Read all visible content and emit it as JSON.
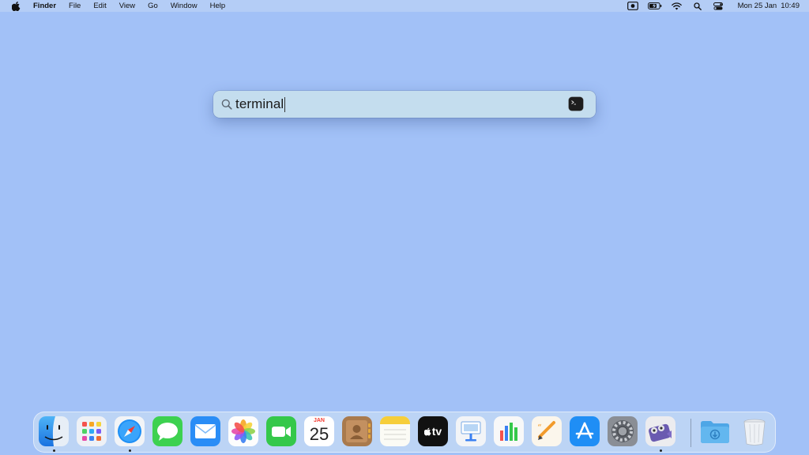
{
  "menubar": {
    "app_name": "Finder",
    "menus": [
      "File",
      "Edit",
      "View",
      "Go",
      "Window",
      "Help"
    ],
    "status_icons": [
      "screen-record-icon",
      "battery-icon",
      "wifi-icon",
      "spotlight-search-icon",
      "control-center-icon"
    ],
    "clock": {
      "date": "Mon 25 Jan",
      "time": "10:49"
    }
  },
  "spotlight": {
    "query": "terminal",
    "top_hit_icon": "terminal-app-icon"
  },
  "dock": {
    "apps": [
      {
        "name": "Finder",
        "icon": "finder-icon",
        "running": true
      },
      {
        "name": "Launchpad",
        "icon": "launchpad-icon",
        "running": false
      },
      {
        "name": "Safari",
        "icon": "safari-icon",
        "running": true
      },
      {
        "name": "Messages",
        "icon": "messages-icon",
        "running": false
      },
      {
        "name": "Mail",
        "icon": "mail-icon",
        "running": false
      },
      {
        "name": "Photos",
        "icon": "photos-icon",
        "running": false
      },
      {
        "name": "FaceTime",
        "icon": "facetime-icon",
        "running": false
      },
      {
        "name": "Calendar",
        "icon": "calendar-icon",
        "running": false
      },
      {
        "name": "Contacts",
        "icon": "contacts-icon",
        "running": false
      },
      {
        "name": "Notes",
        "icon": "notes-icon",
        "running": false
      },
      {
        "name": "TV",
        "icon": "tv-icon",
        "running": false
      },
      {
        "name": "Keynote",
        "icon": "keynote-icon",
        "running": false
      },
      {
        "name": "Numbers",
        "icon": "numbers-icon",
        "running": false
      },
      {
        "name": "Pages",
        "icon": "pages-icon",
        "running": false
      },
      {
        "name": "App Store",
        "icon": "app-store-icon",
        "running": false
      },
      {
        "name": "System Preferences",
        "icon": "system-preferences-icon",
        "running": false
      },
      {
        "name": "Screenium",
        "icon": "screen-recorder-icon",
        "running": true
      }
    ],
    "calendar": {
      "month": "JAN",
      "day": "25"
    },
    "tv_label": "tv",
    "downloads_icon": "downloads-folder-icon",
    "trash_icon": "trash-icon"
  }
}
